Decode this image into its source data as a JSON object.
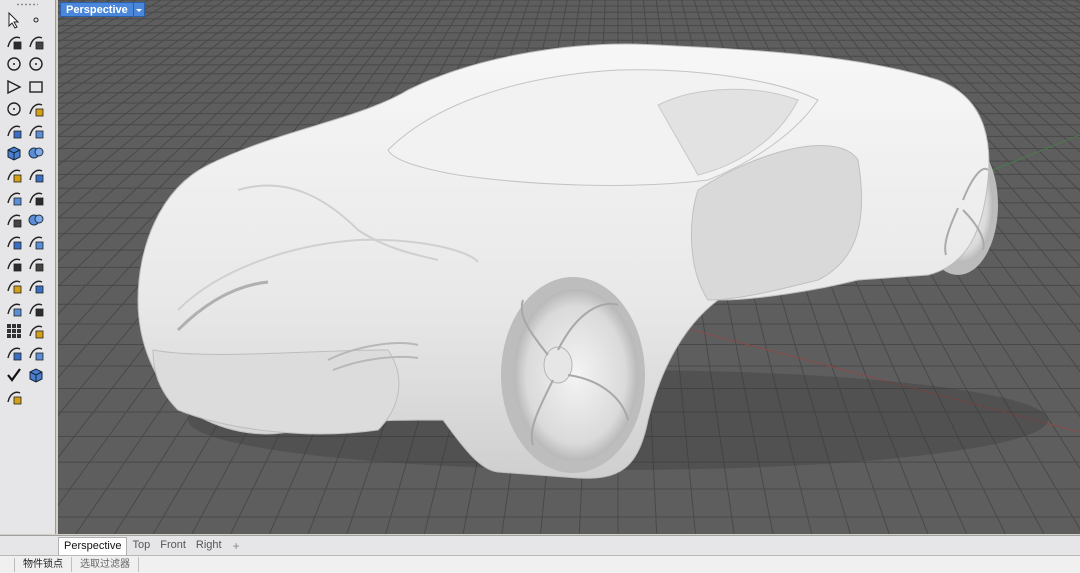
{
  "viewport": {
    "title": "Perspective"
  },
  "tabs": [
    {
      "label": "Perspective",
      "active": true
    },
    {
      "label": "Top",
      "active": false
    },
    {
      "label": "Front",
      "active": false
    },
    {
      "label": "Right",
      "active": false
    }
  ],
  "tab_add": "+",
  "status": {
    "osnap": "物件锁点",
    "selection_filter": "选取过滤器"
  },
  "tools": [
    "select-arrow-icon",
    "point-icon",
    "polyline-icon",
    "curve-points-icon",
    "circle-icon",
    "ellipse-icon",
    "polygon-icon",
    "rectangle-icon",
    "circle-center-icon",
    "arc-icon",
    "surface-icon",
    "surface-edge-icon",
    "box-icon",
    "sphere-icon",
    "cylinder-icon",
    "solid-edit-icon",
    "transform-icon",
    "explode-icon",
    "mesh-icon",
    "boolean-icon",
    "fillet-icon",
    "curve-edit-icon",
    "text-icon",
    "scale-icon",
    "array-icon",
    "mirror-icon",
    "extrude-icon",
    "project-icon",
    "grid-icon",
    "dimension-icon",
    "layer-icon",
    "render-icon",
    "check-icon",
    "display-icon",
    "paint-icon"
  ],
  "colors": {
    "viewport_bg": "#5f5f5f",
    "grid_line": "#4a4a4a",
    "title_blue": "#4a86d9",
    "car_body": "#ececec"
  }
}
